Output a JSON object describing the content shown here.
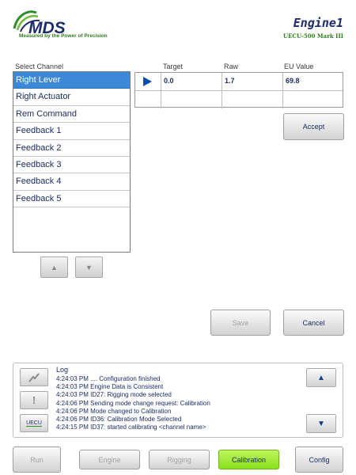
{
  "header": {
    "logo_text": "MDS",
    "logo_tagline": "Measured by the Power of Precision",
    "engine_title": "Engine1",
    "engine_subtitle": "UECU-500 Mark III"
  },
  "channels": {
    "label": "Select Channel",
    "items": [
      "Right Lever",
      "Right Actuator",
      "Rem Command",
      "Feedback 1",
      "Feedback 2",
      "Feedback 3",
      "Feedback 4",
      "Feedback 5"
    ],
    "selected_index": 0
  },
  "grid": {
    "headers": [
      "Target",
      "Raw",
      "EU Value"
    ],
    "rows": [
      {
        "target": "0.0",
        "raw": "1.7",
        "eu": "69.8"
      },
      {
        "target": "",
        "raw": "",
        "eu": ""
      }
    ]
  },
  "buttons": {
    "accept": "Accept",
    "save": "Save",
    "cancel": "Cancel"
  },
  "log": {
    "title": "Log",
    "side_button_label": "UECU",
    "lines": [
      "4:24:03 PM .... Configuration finished",
      "4:24:03 PM Engine Data is Consistent",
      "4:24:03 PM ID27: Rigging mode selected",
      "4:24:06 PM Sending mode change request: Calibration",
      "4:24:06 PM Mode changed to Calibration",
      "4:24:06 PM ID36: Calibration Mode Selected",
      "4:24:15 PM ID37: started calibrating <channel name>"
    ]
  },
  "nav": {
    "run": "Run",
    "engine": "Engine",
    "rigging": "Rigging",
    "calibration": "Calibration",
    "config": "Config",
    "active": "calibration"
  },
  "colors": {
    "selected_row": "#3d89d8",
    "active_tab": "#9be832",
    "text_navy": "#1c2d63",
    "brand_green": "#2f7b1e",
    "brand_navy": "#1e2c6e"
  },
  "icons": {
    "logo": "mds-swoosh-logo",
    "row_pointer": "play-triangle-icon",
    "log_signal": "signal-icon",
    "log_alert": "exclamation-icon"
  }
}
